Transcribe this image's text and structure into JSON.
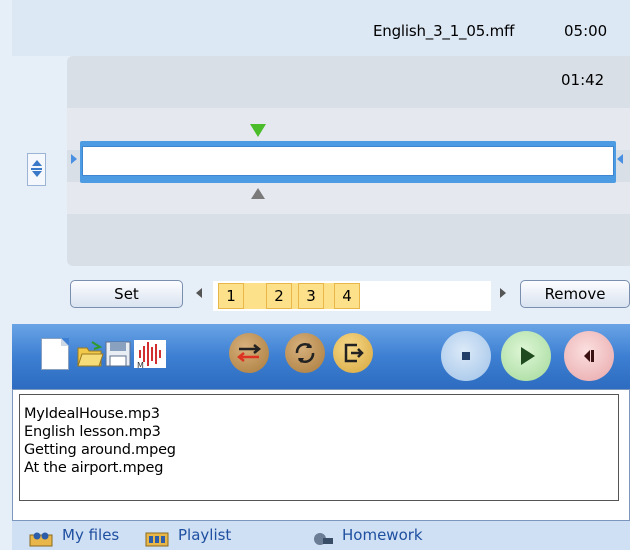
{
  "header": {
    "filename": "English_3_1_05.mff",
    "total_time": "05:00"
  },
  "editor": {
    "current_time": "01:42"
  },
  "controls": {
    "set_label": "Set",
    "remove_label": "Remove",
    "bookmarks": [
      "1",
      "2",
      "3",
      "4"
    ]
  },
  "toolbar": {
    "icons": [
      "new-file-icon",
      "open-folder-icon",
      "save-icon",
      "waveform-icon",
      "mix-icon",
      "repeat-icon",
      "exit-icon",
      "stop-icon",
      "play-icon",
      "record-icon"
    ]
  },
  "files": [
    "MyIdealHouse.mp3",
    "English lesson.mp3",
    "Getting around.mpeg",
    "At the airport.mpeg"
  ],
  "tabs": {
    "my_files": "My files",
    "playlist": "Playlist",
    "homework": "Homework"
  },
  "colors": {
    "toolbar": "#3d7fd2",
    "bookmark": "#fce08a",
    "marker_green": "#4bbd2b",
    "scrub": "#4c9be3"
  }
}
